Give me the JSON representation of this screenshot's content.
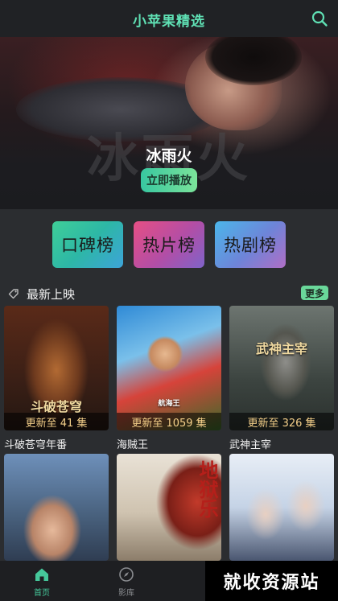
{
  "header": {
    "title": "小苹果精选",
    "search_icon": "search-icon"
  },
  "hero": {
    "title": "冰雨火",
    "watermark": "冰雨火",
    "play_label": "立即播放"
  },
  "rankings": [
    {
      "label": "口碑榜"
    },
    {
      "label": "热片榜"
    },
    {
      "label": "热剧榜"
    }
  ],
  "section": {
    "title": "最新上映",
    "more_label": "更多",
    "tag_icon": "tag-icon"
  },
  "cards": [
    {
      "title": "斗破苍穹年番",
      "badge": "更新至 41 集",
      "poster_text": "斗破苍穹"
    },
    {
      "title": "海贼王",
      "badge": "更新至 1059 集",
      "poster_text": "航海王"
    },
    {
      "title": "武神主宰",
      "badge": "更新至 326 集",
      "poster_text": "武神主宰"
    },
    {
      "title": "",
      "badge": "",
      "poster_text": ""
    },
    {
      "title": "",
      "badge": "",
      "poster_text": "地狱乐"
    },
    {
      "title": "",
      "badge": "",
      "poster_text": ""
    }
  ],
  "tabbar": {
    "items": [
      {
        "label": "首页",
        "icon": "home-icon",
        "active": true
      },
      {
        "label": "影库",
        "icon": "compass-icon",
        "active": false
      }
    ]
  },
  "watermark_overlay": "就收资源站",
  "colors": {
    "accent": "#45c79a",
    "badge_text": "#f5d08a",
    "background": "#2b2d30"
  }
}
